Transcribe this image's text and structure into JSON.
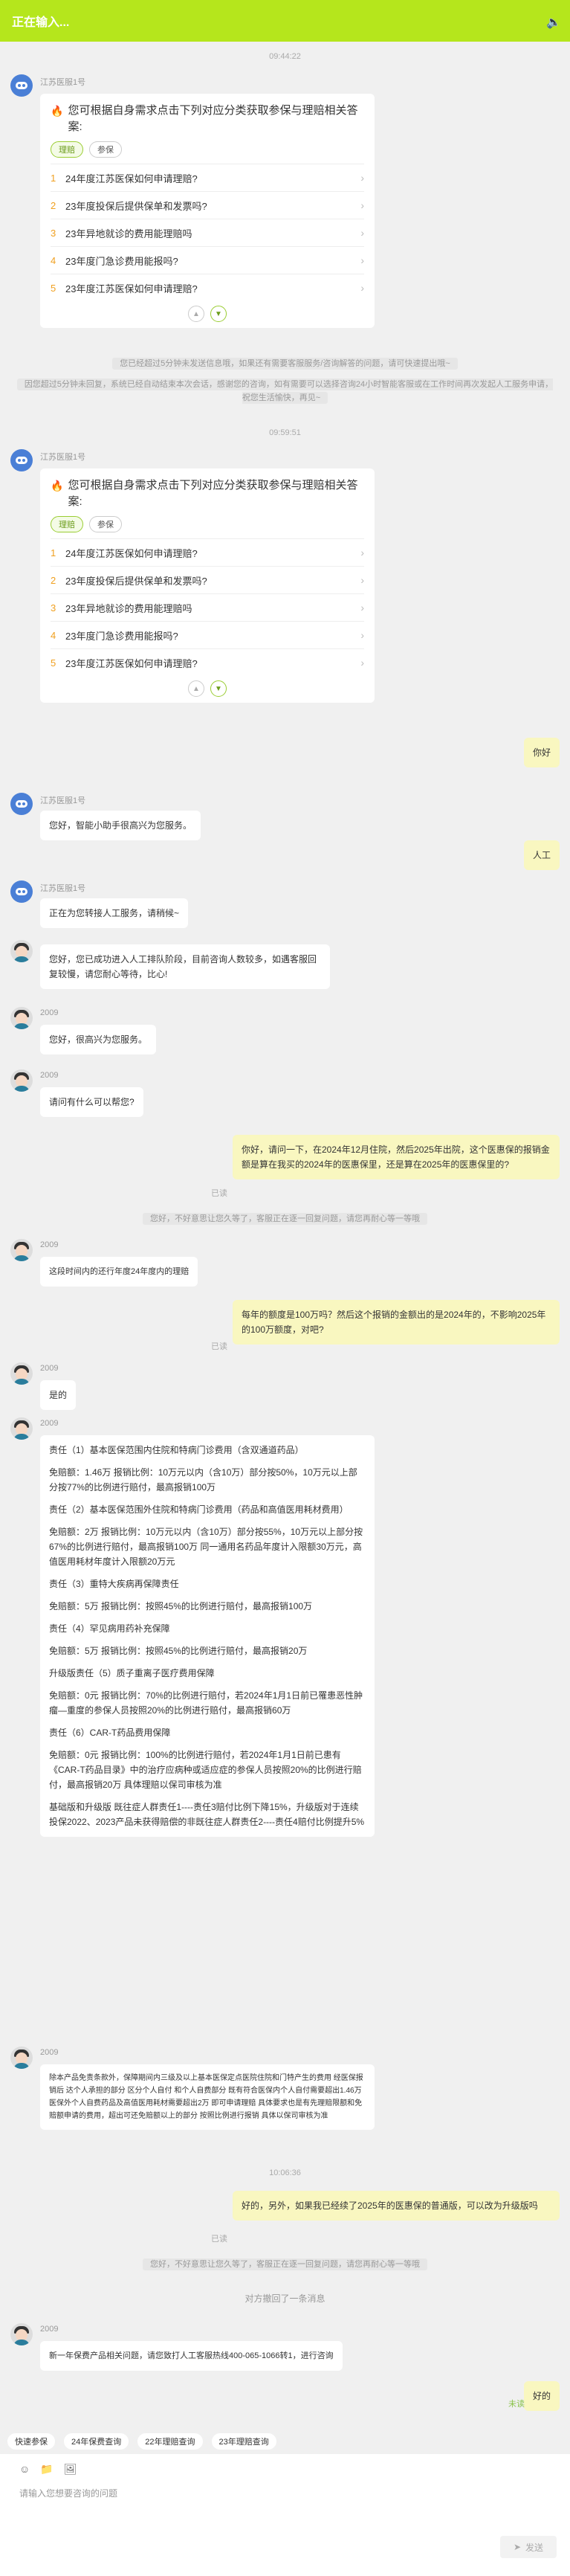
{
  "header": {
    "title": "正在输入...",
    "speaker_icon": "speaker-icon"
  },
  "times": [
    "09:44:22",
    "09:59:51",
    "10:06:36"
  ],
  "bot_name": "江苏医服1号",
  "card": {
    "question": "您可根据自身需求点击下列对应分类获取参保与理赔相关答案:",
    "tags": [
      "理赔",
      "参保"
    ],
    "items": [
      "24年度江苏医保如何申请理赔?",
      "23年度投保后提供保单和发票吗?",
      "23年异地就诊的费用能理赔吗",
      "23年度门急诊费用能报吗?",
      "23年度江苏医保如何申请理赔?"
    ]
  },
  "sys1": "您已经超过5分钟未发送信息哦，如果还有需要客服服务/咨询解答的问题，请可快速提出哦~",
  "sys2": "因您超过5分钟未回复，系统已经自动结束本次会话，感谢您的咨询，如有需要可以选择咨询24小时智能客服或在工作时间再次发起人工服务申请，祝您生活愉快，再见~",
  "msgs": {
    "u1": "你好",
    "b1": "您好，智能小助手很高兴为您服务。",
    "u2": "人工",
    "b2": "正在为您转接人工服务，请稍候~",
    "h1": "您好，您已成功进入人工排队阶段，目前咨询人数较多，如遇客服回复较慢，请您耐心等待，比心!",
    "agent": "2009",
    "h2": "您好，很高兴为您服务。",
    "h3": "请问有什么可以帮您?",
    "u3": "你好，请问一下，在2024年12月住院，然后2025年出院，这个医惠保的报销金额是算在我买的2024年的医惠保里，还是算在2025年的医惠保里的?",
    "read": "已读",
    "sys3": "您好，不好意思让您久等了，客服正在逐一回复问题，请您再耐心等一等哦",
    "h4": "这段时间内的还行年度24年度内的理赔",
    "u4": "每年的额度是100万吗？然后这个报销的金额出的是2024年的，不影响2025年的100万额度，对吧?",
    "h5": "是的",
    "h6": [
      "责任（1）基本医保范围内住院和特病门诊费用（含双通道药品）",
      "免赔额：1.46万  报销比例：10万元以内（含10万）部分按50%，10万元以上部分按77%的比例进行赔付，最高报销100万",
      "责任（2）基本医保范围外住院和特病门诊费用（药品和高值医用耗材费用）",
      "免赔额：2万  报销比例：10万元以内（含10万）部分按55%，10万元以上部分按67%的比例进行赔付，最高报销100万 同一通用名药品年度计入限额30万元，高值医用耗材年度计入限额20万元",
      "责任（3）重特大疾病再保障责任",
      "免赔额：5万    报销比例：按照45%的比例进行赔付，最高报销100万",
      "责任（4）罕见病用药补充保障",
      "免赔额：5万     报销比例：按照45%的比例进行赔付，最高报销20万",
      "升级版责任（5）质子重离子医疗费用保障",
      "免赔额：0元    报销比例：70%的比例进行赔付，若2024年1月1日前已罹患恶性肿瘤—重度的参保人员按照20%的比例进行赔付，最高报销60万",
      "责任（6）CAR-T药品费用保障",
      "免赔额：0元    报销比例：100%的比例进行赔付，若2024年1月1日前已患有《CAR-T药品目录》中的治疗应病种或适应症的参保人员按照20%的比例进行赔付，最高报销20万   具体理赔以保司审核为准",
      "基础版和升级版  既往症人群责任1----责任3赔付比例下降15%，升级版对于连续投保2022、2023产品未获得赔偿的非既往症人群责任2----责任4赔付比例提升5%"
    ],
    "h7": "除本产品免责条款外，保障期间内三级及以上基本医保定点医院住院和门特产生的费用 经医保报销后 达个人承担的部分 区分个人自付 和个人自费部分   既有符合医保内个人自付需要超出1.46万 医保外个人自费药品及高值医用耗材需要超出2万 即可申请理赔 具体要求也是有先理赔限额和免赔额申请的费用，超出可还免赔额以上的部分 按照比例进行报销 具体以保司审核为准",
    "u5": "好的，另外，如果我已经续了2025年的医惠保的普通版，可以改为升级版吗",
    "sys4": "您好，不好意思让您久等了，客服正在逐一回复问题，请您再耐心等一等哦",
    "sys5": "对方撤回了一条消息",
    "h8": "新一年保费产品相关问题，请您致打人工客服热线400-065-1066转1，进行咨询",
    "u6": "好的",
    "read2": "未读"
  },
  "quick": [
    "快速参保",
    "24年保费查询",
    "22年理赔查询",
    "23年理赔查询"
  ],
  "input": {
    "placeholder": "请输入您想要咨询的问题",
    "send": "发送"
  }
}
